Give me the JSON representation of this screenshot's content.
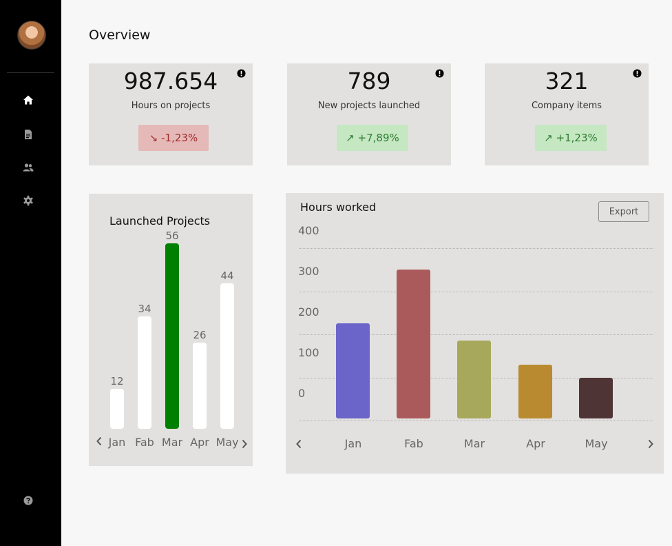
{
  "page": {
    "title": "Overview"
  },
  "sidebar": {
    "avatar_alt": "User avatar",
    "items": [
      {
        "name": "home",
        "icon": "home-icon",
        "active": true
      },
      {
        "name": "documents",
        "icon": "document-icon",
        "active": false
      },
      {
        "name": "users",
        "icon": "users-icon",
        "active": false
      },
      {
        "name": "settings",
        "icon": "gear-icon",
        "active": false
      }
    ],
    "help_icon": "help-icon"
  },
  "kpis": [
    {
      "value": "987.654",
      "label": "Hours on projects",
      "change": "↘ -1,23%",
      "trend": "negative"
    },
    {
      "value": "789",
      "label": "New projects launched",
      "change": "↗ +7,89%",
      "trend": "positive"
    },
    {
      "value": "321",
      "label": "Company items",
      "change": "↗ +1,23%",
      "trend": "positive"
    }
  ],
  "colors": {
    "sidebar_bg": "#000000",
    "panel_bg": "#e2e1df",
    "negative_badge_bg": "#e5b9b8",
    "negative_text": "#9f2c2c",
    "positive_badge_bg": "#c5e7c2",
    "positive_text": "#2e7d32",
    "highlight_bar": "#008000",
    "default_bar": "#ffffff"
  },
  "chart_data": [
    {
      "type": "bar",
      "title": "Launched Projects",
      "categories": [
        "Jan",
        "Fab",
        "Mar",
        "Apr",
        "May"
      ],
      "values": [
        12,
        34,
        56,
        26,
        44
      ],
      "highlight_index": 2,
      "colors": [
        "#ffffff",
        "#ffffff",
        "#008000",
        "#ffffff",
        "#ffffff"
      ],
      "data_labels": true,
      "grid": false
    },
    {
      "type": "bar",
      "title": "Hours worked",
      "categories": [
        "Jan",
        "Fab",
        "Mar",
        "Apr",
        "May"
      ],
      "values": [
        220,
        345,
        180,
        125,
        95
      ],
      "ticks": [
        "400",
        "300",
        "200",
        "100",
        "0"
      ],
      "ylim": [
        0,
        400
      ],
      "colors": [
        "#6b65c9",
        "#ab5a5b",
        "#a8a85d",
        "#b98a30",
        "#4f3435"
      ],
      "grid": true,
      "export_label": "Export"
    }
  ]
}
